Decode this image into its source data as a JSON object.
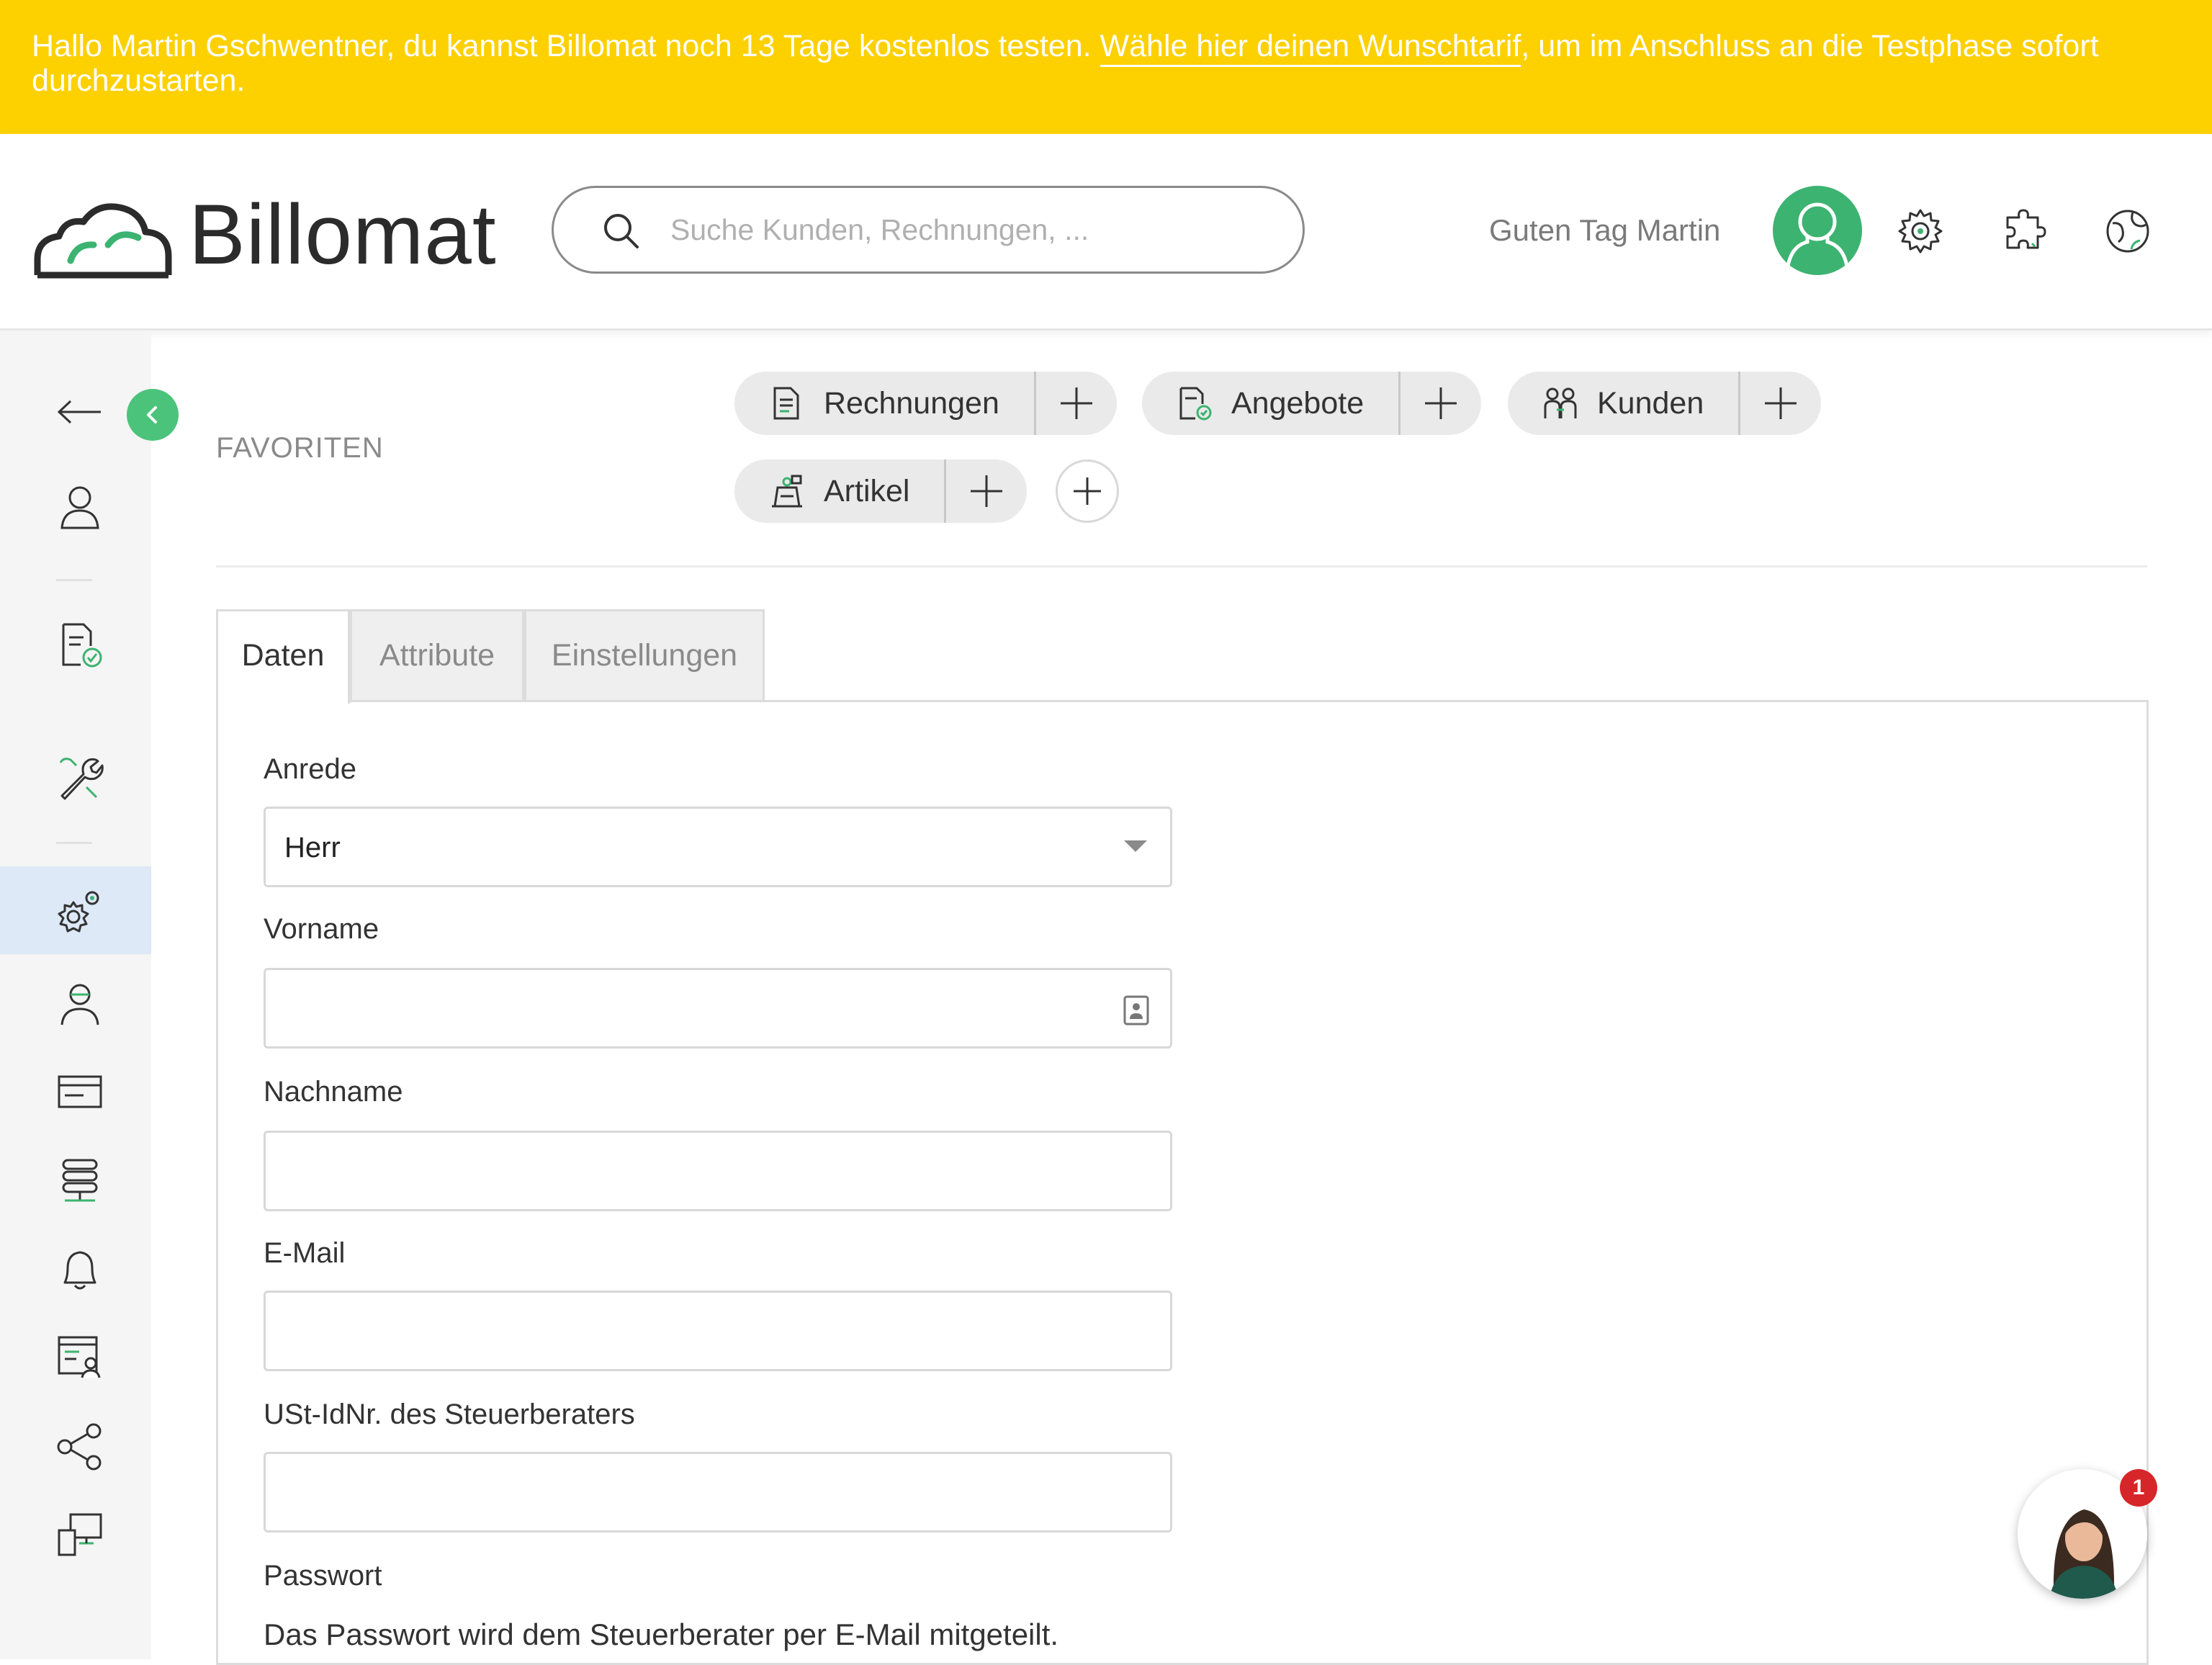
{
  "banner": {
    "text_before": "Hallo Martin Gschwentner, du kannst Billomat noch 13 Tage kostenlos testen. ",
    "link_text": "Wähle hier deinen Wunschtarif",
    "text_after": ", um im Anschluss an die Testphase sofort durchzustarten."
  },
  "header": {
    "brand": "Billomat",
    "search_placeholder": "Suche Kunden, Rechnungen, ...",
    "greeting": "Guten Tag Martin",
    "icons": [
      "user-avatar",
      "gear-icon",
      "puzzle-icon",
      "globe-icon"
    ]
  },
  "sidebar": {
    "items": [
      "back-arrow-icon",
      "user-icon",
      "invoice-check-icon",
      "tools-icon",
      "settings-gears-icon",
      "support-person-icon",
      "card-icon",
      "server-icon",
      "bell-icon",
      "report-user-icon",
      "share-icon",
      "devices-icon"
    ],
    "active": "settings-gears-icon"
  },
  "favorites": {
    "label": "FAVORITEN",
    "items": [
      {
        "label": "Rechnungen",
        "icon": "invoice-icon"
      },
      {
        "label": "Angebote",
        "icon": "offer-icon"
      },
      {
        "label": "Kunden",
        "icon": "customers-icon"
      },
      {
        "label": "Artikel",
        "icon": "article-icon"
      }
    ]
  },
  "tabs": [
    {
      "label": "Daten",
      "active": true
    },
    {
      "label": "Attribute",
      "active": false
    },
    {
      "label": "Einstellungen",
      "active": false
    }
  ],
  "form": {
    "anrede_label": "Anrede",
    "anrede_value": "Herr",
    "vorname_label": "Vorname",
    "vorname_value": "",
    "nachname_label": "Nachname",
    "nachname_value": "",
    "email_label": "E-Mail",
    "email_value": "",
    "ustid_label": "USt-IdNr. des Steuerberaters",
    "ustid_value": "",
    "passwort_label": "Passwort",
    "passwort_note": "Das Passwort wird dem Steuerberater per E-Mail mitgeteilt."
  },
  "chat": {
    "badge_count": "1"
  },
  "colors": {
    "banner": "#fdd000",
    "accent_green": "#3cb371",
    "active_nav": "#dde9f7"
  }
}
